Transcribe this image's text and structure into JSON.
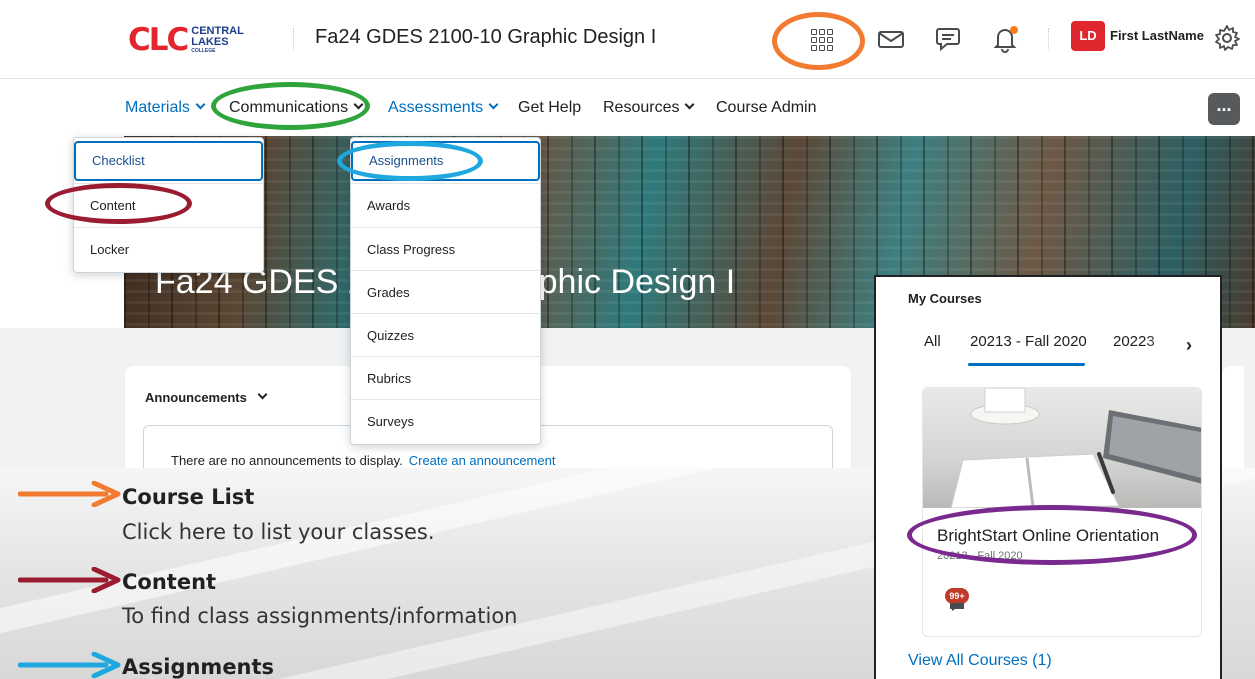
{
  "header": {
    "logo_text": "CLC",
    "logo_sub_line1": "CENTRAL",
    "logo_sub_line2": "LAKES",
    "logo_sub_line3": "COLLEGE",
    "course_title": "Fa24 GDES 2100-10 Graphic Design I",
    "avatar_initials": "LD",
    "user_name": "First LastName",
    "icons": [
      "waffle-course-list-icon",
      "mail-icon",
      "chat-icon",
      "bell-icon",
      "gear-icon"
    ],
    "notification_dot_color": "#f57c1f"
  },
  "nav": {
    "items": [
      {
        "label": "Materials",
        "has_chevron": true
      },
      {
        "label": "Communications",
        "has_chevron": true
      },
      {
        "label": "Assessments",
        "has_chevron": true
      },
      {
        "label": "Get Help",
        "has_chevron": false
      },
      {
        "label": "Resources",
        "has_chevron": true
      },
      {
        "label": "Course Admin",
        "has_chevron": false
      }
    ],
    "more_label": "..."
  },
  "materials_menu": [
    "Checklist",
    "Content",
    "Locker"
  ],
  "assessments_menu": [
    "Assignments",
    "Awards",
    "Class Progress",
    "Grades",
    "Quizzes",
    "Rubrics",
    "Surveys"
  ],
  "banner_title": "Fa24 GDES 2100-10 Graphic Design I",
  "announcements": {
    "heading": "Announcements",
    "empty_text": "There are no announcements to display.",
    "create_link": "Create an announcement"
  },
  "my_courses": {
    "title": "My Courses",
    "tabs": [
      "All",
      "20213 - Fall 2020",
      "20223"
    ],
    "course_name": "BrightStart Online Orientation",
    "course_term": "20213 - Fall 2020",
    "badge": "99+",
    "view_all": "View All Courses (1)"
  },
  "tips": [
    {
      "title": "Course List",
      "body": "Click here to list your classes.",
      "color": "#f27a31"
    },
    {
      "title": "Content",
      "body": "To find class assignments/information",
      "color": "#9b1c31"
    },
    {
      "title": "Assignments",
      "body": "",
      "color": "#1fa8e0"
    }
  ],
  "highlight_colors": {
    "orange": "#f27a31",
    "green": "#2ea43a",
    "blue": "#1fa8e0",
    "maroon": "#9b1c31",
    "purple": "#7a2a8f"
  }
}
